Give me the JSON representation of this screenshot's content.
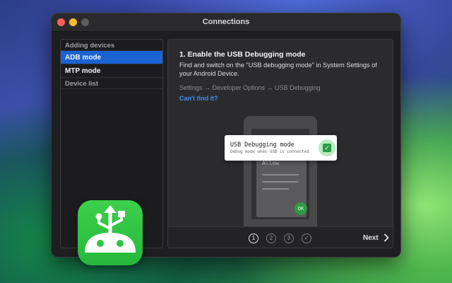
{
  "window": {
    "title": "Connections"
  },
  "sidebar": {
    "section_adding": "Adding devices",
    "items": [
      {
        "label": "ADB mode",
        "selected": true
      },
      {
        "label": "MTP mode",
        "selected": false
      }
    ],
    "section_device_list": "Device list"
  },
  "content": {
    "step_title": "1. Enable the USB Debugging mode",
    "step_description": "Find and switch on the \"USB debugging mode\" in System Settings of your Android Device.",
    "settings_path": "Settings → Developer Options → USB Debugging",
    "help_link": "Can't find it?",
    "phone_dialog": {
      "allow_text": "Allow",
      "ok_label": "OK"
    },
    "toast": {
      "title": "USB Debugging mode",
      "subtitle": "Debug mode when USB is connected",
      "enabled": true
    }
  },
  "footer": {
    "steps": [
      "1",
      "2",
      "3",
      "✓"
    ],
    "active_step": 1,
    "next_label": "Next"
  },
  "colors": {
    "accent": "#1a63d3",
    "link": "#3b8ff0",
    "app_green": "#2fc443"
  },
  "icons": [
    "close-light",
    "minimize-light",
    "zoom-light",
    "checkbox-icon",
    "chevron-right-icon",
    "usb-android-app-icon"
  ]
}
